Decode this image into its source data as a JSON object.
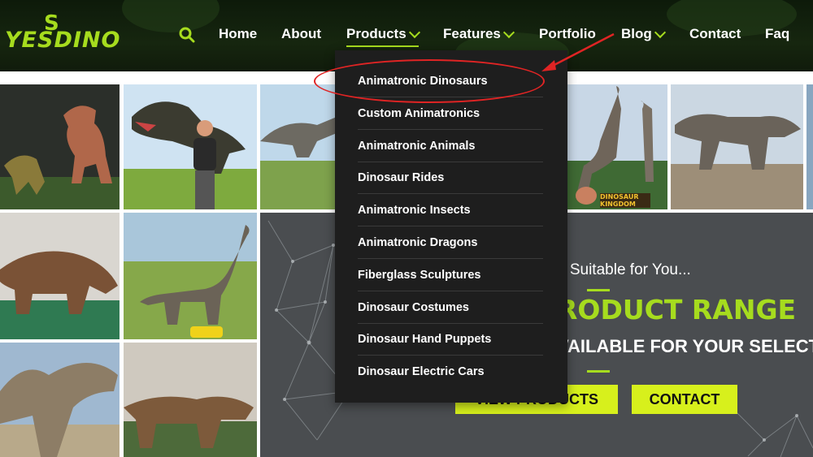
{
  "brand": {
    "logo_text": "YESDINO",
    "accent_color": "#a6dc1e"
  },
  "nav": {
    "search_icon": "search-icon",
    "items": [
      {
        "label": "Home"
      },
      {
        "label": "About"
      },
      {
        "label": "Products",
        "active": true,
        "has_dropdown": true
      },
      {
        "label": "Features",
        "has_dropdown": true
      },
      {
        "label": "Portfolio"
      },
      {
        "label": "Blog",
        "has_dropdown": true
      },
      {
        "label": "Contact"
      },
      {
        "label": "Faq"
      }
    ]
  },
  "products_menu": {
    "items": [
      "Animatronic Dinosaurs",
      "Custom Animatronics",
      "Animatronic Animals",
      "Dinosaur Rides",
      "Animatronic Insects",
      "Animatronic Dragons",
      "Fiberglass Sculptures",
      "Dinosaur Costumes",
      "Dinosaur Hand Puppets",
      "Dinosaur Electric Cars"
    ],
    "highlighted_item": "Animatronic Dinosaurs"
  },
  "promo": {
    "subtitle": "e Suitable for You...",
    "title": "RODUCT RANGE",
    "line2": "VAILABLE FOR YOUR SELECT",
    "view_button": "VIEW PRODUCTS",
    "contact_button": "CONTACT",
    "button_color": "#d7f01c"
  },
  "gallery": {
    "sign_text": "DINOSAUR KINGDOM"
  },
  "annotation": {
    "color": "#e02424"
  }
}
